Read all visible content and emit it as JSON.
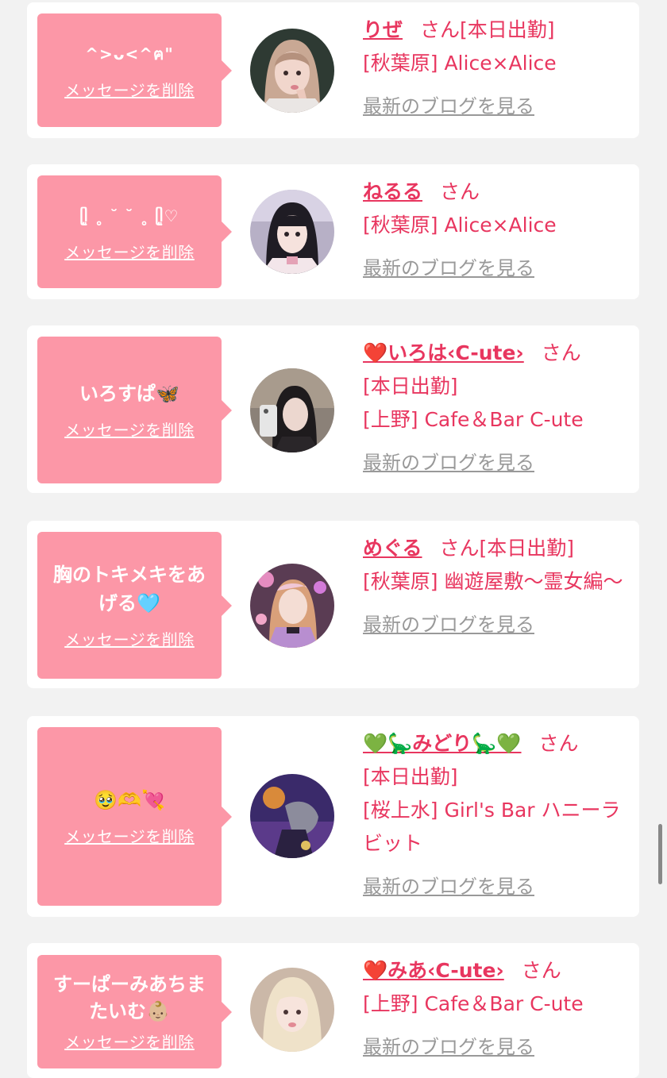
{
  "delete_label": "メッセージを削除",
  "blog_label": "最新のブログを見る",
  "san_label": "さん",
  "colors": {
    "bubble": "#fc97a7",
    "accent": "#e8365f",
    "muted": "#999999",
    "background": "#f2f2f2"
  },
  "entries": [
    {
      "message": "^>ᴗ<^ฅ\"",
      "name": "りぜ",
      "status": "[本日出勤]",
      "shop": "[秋葉原] Alice×Alice"
    },
    {
      "message": "ᥫ͈ ˳ ˘ ˘ ˳ ᥫ͈♡",
      "name": "ねるる",
      "status": "",
      "shop": "[秋葉原] Alice×Alice"
    },
    {
      "message": "いろすぱ🦋",
      "name": "❤️いろは‹C-ute›",
      "status": "[本日出勤]",
      "shop": "[上野] Cafe＆Bar C-ute"
    },
    {
      "message": "胸のトキメキをあげる🩵",
      "name": "めぐる",
      "status": "[本日出勤]",
      "shop": "[秋葉原] 幽遊屋敷〜霊女編〜"
    },
    {
      "message": "🥹🫶💘",
      "name": "💚🦕みどり🦕💚",
      "status": "[本日出勤]",
      "shop": "[桜上水] Girl's Bar ハニーラビット"
    },
    {
      "message": "すーぱーみあちまたいむ👶🏼",
      "name": "❤️みあ‹C-ute›",
      "status": "",
      "shop": "[上野] Cafe＆Bar C-ute"
    }
  ]
}
